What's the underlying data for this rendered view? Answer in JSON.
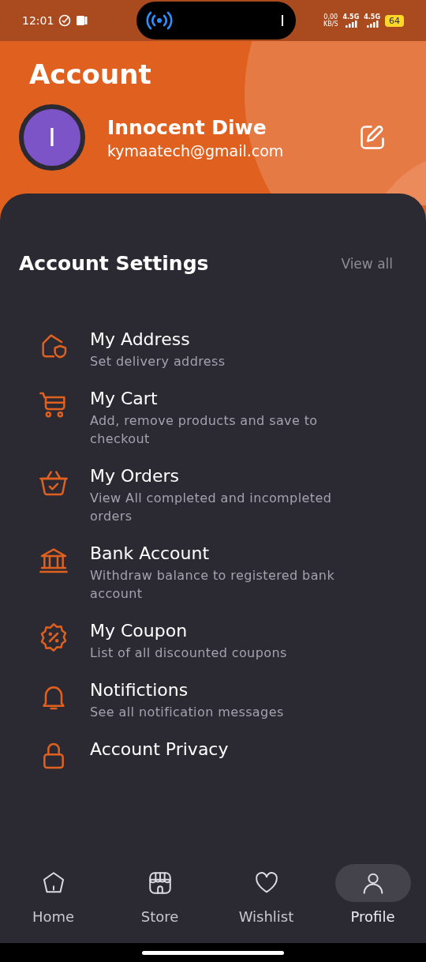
{
  "status_bar": {
    "time": "12:01",
    "speed": "0,00",
    "speed_unit": "KB/S",
    "networks": [
      "4.5G",
      "4.5G"
    ],
    "battery": "64"
  },
  "header": {
    "title": "Account",
    "profile": {
      "initial": "I",
      "name": "Innocent Diwe",
      "email": "kymaatech@gmail.com"
    }
  },
  "section": {
    "title": "Account Settings",
    "action": "View all"
  },
  "items": [
    {
      "kind": "address",
      "title": "My Address",
      "subtitle": "Set delivery address"
    },
    {
      "kind": "cart",
      "title": "My Cart",
      "subtitle": "Add, remove products and save to checkout"
    },
    {
      "kind": "orders",
      "title": "My Orders",
      "subtitle": "View All completed and incompleted orders"
    },
    {
      "kind": "bank",
      "title": "Bank Account",
      "subtitle": "Withdraw balance to registered bank account"
    },
    {
      "kind": "coupon",
      "title": "My Coupon",
      "subtitle": "List of all discounted coupons"
    },
    {
      "kind": "bell",
      "title": "Notifictions",
      "subtitle": "See all notification messages"
    },
    {
      "kind": "privacy",
      "title": "Account Privacy"
    }
  ],
  "nav": [
    {
      "kind": "home",
      "label": "Home",
      "selected": false
    },
    {
      "kind": "store",
      "label": "Store",
      "selected": false
    },
    {
      "kind": "wishlist",
      "label": "Wishlist",
      "selected": false
    },
    {
      "kind": "profile",
      "label": "Profile",
      "selected": true
    }
  ]
}
